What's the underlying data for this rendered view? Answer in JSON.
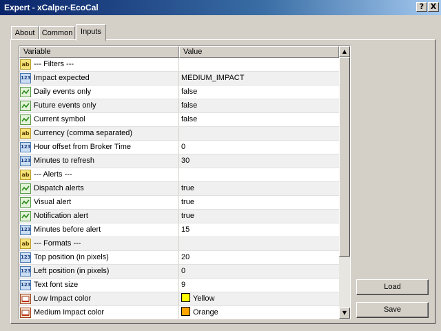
{
  "window": {
    "title": "Expert - xCalper-EcoCal",
    "help_glyph": "?",
    "close_glyph": "X"
  },
  "tabs": [
    {
      "label": "About"
    },
    {
      "label": "Common"
    },
    {
      "label": "Inputs",
      "active": true
    }
  ],
  "grid": {
    "columns": [
      "Variable",
      "Value"
    ],
    "rows": [
      {
        "icon": "ab",
        "variable": "--- Filters ---",
        "value": ""
      },
      {
        "icon": "123",
        "variable": "Impact expected",
        "value": "MEDIUM_IMPACT"
      },
      {
        "icon": "bool",
        "variable": "Daily events only",
        "value": "false"
      },
      {
        "icon": "bool",
        "variable": "Future events only",
        "value": "false"
      },
      {
        "icon": "bool",
        "variable": "Current symbol",
        "value": "false"
      },
      {
        "icon": "ab",
        "variable": "Currency (comma separated)",
        "value": ""
      },
      {
        "icon": "123",
        "variable": "Hour offset from Broker Time",
        "value": "0"
      },
      {
        "icon": "123",
        "variable": "Minutes to refresh",
        "value": "30"
      },
      {
        "icon": "ab",
        "variable": "--- Alerts ---",
        "value": ""
      },
      {
        "icon": "bool",
        "variable": "Dispatch alerts",
        "value": "true"
      },
      {
        "icon": "bool",
        "variable": "Visual alert",
        "value": "true"
      },
      {
        "icon": "bool",
        "variable": "Notification alert",
        "value": "true"
      },
      {
        "icon": "123",
        "variable": "Minutes before alert",
        "value": "15"
      },
      {
        "icon": "ab",
        "variable": "--- Formats ---",
        "value": ""
      },
      {
        "icon": "123",
        "variable": "Top position (in pixels)",
        "value": "20"
      },
      {
        "icon": "123",
        "variable": "Left position (in pixels)",
        "value": "0"
      },
      {
        "icon": "123",
        "variable": "Text font size",
        "value": "9"
      },
      {
        "icon": "color",
        "variable": "Low Impact color",
        "value": "Yellow",
        "swatch": "#ffff00"
      },
      {
        "icon": "color",
        "variable": "Medium Impact color",
        "value": "Orange",
        "swatch": "#ffa500"
      }
    ]
  },
  "scrollbar": {
    "up_glyph": "▲",
    "down_glyph": "▼"
  },
  "buttons": {
    "load_label": "Load",
    "save_label": "Save"
  },
  "icon_labels": {
    "ab": "ab",
    "123": "123"
  }
}
